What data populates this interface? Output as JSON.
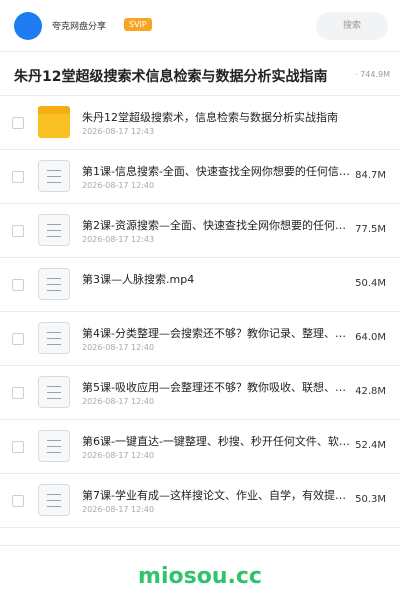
{
  "header": {
    "app_name": "夸克网盘分享",
    "badge": "SVIP",
    "search_placeholder": "搜索"
  },
  "share": {
    "title": "朱丹12堂超级搜索术信息检索与数据分析实战指南",
    "total_size": "· 744.9M"
  },
  "files": [
    {
      "type": "folder",
      "name": "朱丹12堂超级搜索术，信息检索与数据分析实战指南",
      "date": "2026-08-17 12:43",
      "size": ""
    },
    {
      "type": "doc",
      "name": "第1课-信息搜索-全面、快速查找全网你想要的任何信…",
      "date": "2026-08-17 12:40",
      "size": "84.7M"
    },
    {
      "type": "doc",
      "name": "第2课-资源搜索—全面、快速查找全网你想要的任何信…",
      "date": "2026-08-17 12:43",
      "size": "77.5M"
    },
    {
      "type": "doc",
      "name": "第3课—人脉搜索.mp4",
      "date": "",
      "size": "50.4M"
    },
    {
      "type": "doc",
      "name": "第4课-分类整理—会搜索还不够？教你记录、整理、分…",
      "date": "2026-08-17 12:40",
      "size": "64.0M"
    },
    {
      "type": "doc",
      "name": "第5课-吸收应用—会整理还不够？教你吸收、联想、输…",
      "date": "2026-08-17 12:40",
      "size": "42.8M"
    },
    {
      "type": "doc",
      "name": "第6课-一键直达-一键整理、秒搜、秒开任何文件、软…",
      "date": "2026-08-17 12:40",
      "size": "52.4M"
    },
    {
      "type": "doc",
      "name": "第7课-学业有成—这样搜论文、作业、自学，有效提升…",
      "date": "2026-08-17 12:40",
      "size": "50.3M"
    }
  ],
  "footer": {
    "watermark": "miosou.cc"
  },
  "colors": {
    "accent": "#1f7bf2",
    "badge": "#f6a623",
    "folder": "#f8c022",
    "watermark": "#2fc36b"
  }
}
